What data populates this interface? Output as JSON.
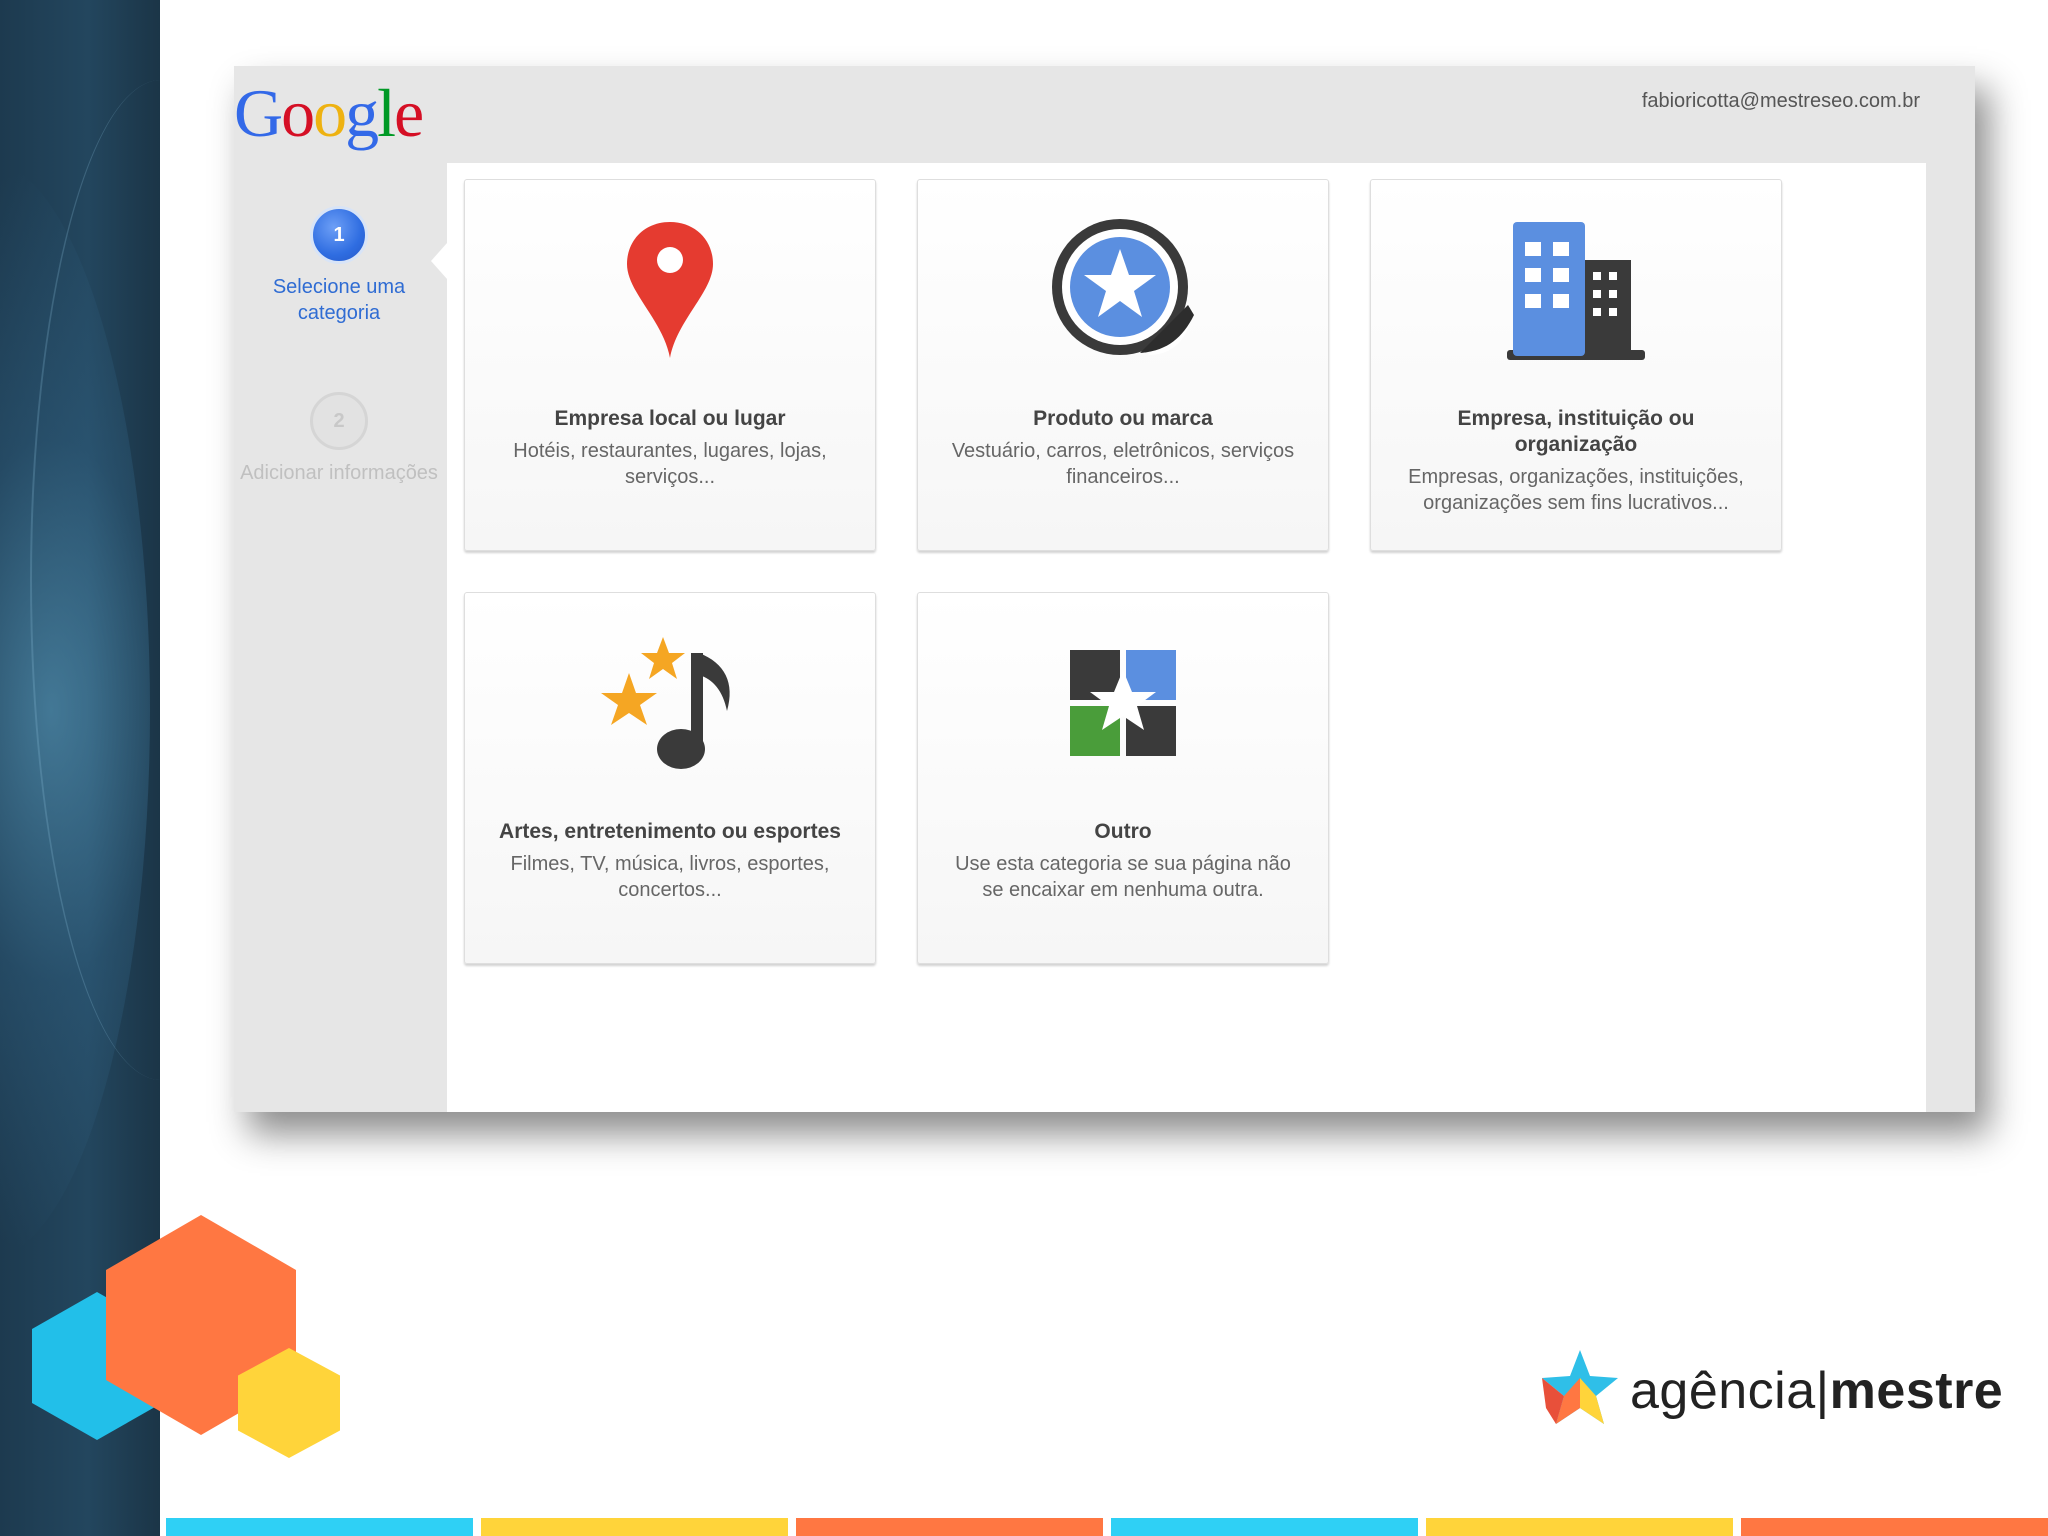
{
  "window": {
    "logo_text": "Google",
    "account_email": "fabioricotta@mestreseo.com.br"
  },
  "steps": [
    {
      "number": "1",
      "label": "Selecione uma categoria",
      "active": true
    },
    {
      "number": "2",
      "label": "Adicionar informações",
      "active": false
    }
  ],
  "categories": [
    {
      "title": "Empresa local ou lugar",
      "description": "Hotéis, restaurantes, lugares, lojas, serviços...",
      "icon": "map-pin-icon"
    },
    {
      "title": "Produto ou marca",
      "description": "Vestuário, carros, eletrônicos, serviços financeiros...",
      "icon": "star-badge-icon"
    },
    {
      "title": "Empresa, instituição ou organização",
      "description": "Empresas, organizações, instituições, organizações sem fins lucrativos...",
      "icon": "building-icon"
    },
    {
      "title": "Artes, entretenimento ou esportes",
      "description": "Filmes, TV, música, livros, esportes, concertos...",
      "icon": "music-stars-icon"
    },
    {
      "title": "Outro",
      "description": "Use esta categoria se sua página não se encaixar em nenhuma outra.",
      "icon": "puzzle-star-icon"
    }
  ],
  "brand": {
    "part1": "agência",
    "separator": "|",
    "part2": "mestre"
  },
  "colors": {
    "google_blue": "#3369e8",
    "google_red": "#d50f25",
    "google_yellow": "#eeb211",
    "google_green": "#009925",
    "hex_cyan": "#22bfe9",
    "hex_orange": "#ff7742",
    "hex_yellow": "#ffd43a",
    "stripe_colors": [
      "#2fd0f5",
      "#ffd43a",
      "#ff7742",
      "#2fd0f5",
      "#ffd43a",
      "#ff7742"
    ]
  }
}
